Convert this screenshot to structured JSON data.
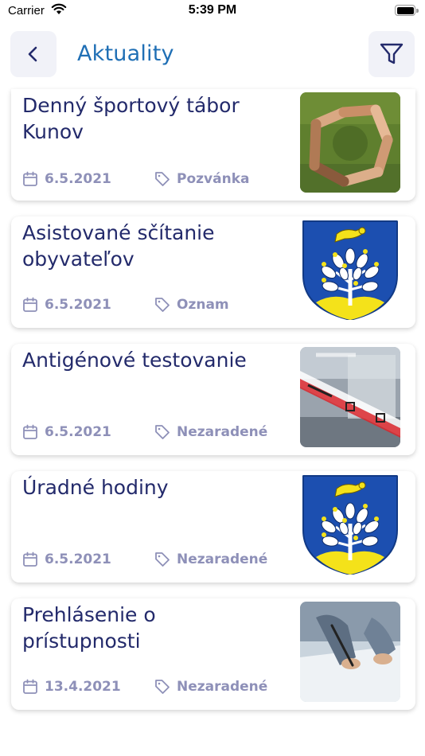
{
  "status_bar": {
    "carrier": "Carrier",
    "time": "5:39 PM"
  },
  "header": {
    "title": "Aktuality",
    "back_icon": "chevron-left-icon",
    "filter_icon": "filter-funnel-icon"
  },
  "colors": {
    "title_blue": "#1f6fb5",
    "card_title": "#232a6b",
    "meta_gray": "#8e90b8",
    "button_bg": "#f1f2f8"
  },
  "articles": [
    {
      "title": "Denný športový tábor Kunov",
      "date": "6.5.2021",
      "category": "Pozvánka",
      "image": "joined-hands-circle-photo"
    },
    {
      "title": "Asistované sčítanie obyvateľov",
      "date": "6.5.2021",
      "category": "Oznam",
      "image": "municipal-coat-of-arms"
    },
    {
      "title": "Antigénové testovanie",
      "date": "6.5.2021",
      "category": "Nezaradené",
      "image": "covid-test-photo"
    },
    {
      "title": "Úradné hodiny",
      "date": "6.5.2021",
      "category": "Nezaradené",
      "image": "municipal-coat-of-arms"
    },
    {
      "title": "Prehlásenie o prístupnosti",
      "date": "13.4.2021",
      "category": "Nezaradené",
      "image": "signing-document-photo"
    }
  ]
}
